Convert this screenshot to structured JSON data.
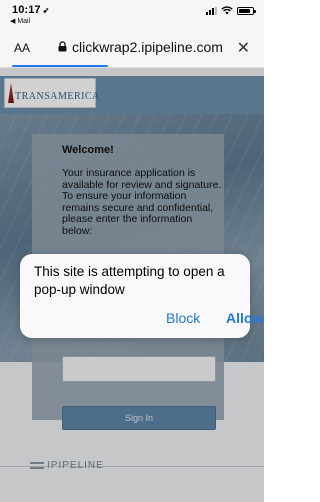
{
  "status_bar": {
    "time": "10:17",
    "location_glyph": "➶",
    "back_app": "◀ Mail"
  },
  "address_bar": {
    "text_size_label": "AA",
    "url": "clickwrap2.ipipeline.com",
    "close": "✕"
  },
  "page": {
    "logo": "TRANSAMERICA",
    "welcome": "Welcome!",
    "intro": "Your insurance application is available for review and signature. To ensure your information remains secure and confidential, please enter the information below:",
    "sign_in": "Sign In",
    "footer_logo": "IPIPELINE"
  },
  "dialog": {
    "message": "This site is attempting to open a pop-up window",
    "block": "Block",
    "allow": "Allow"
  },
  "colors": {
    "accent": "#1f7ae0",
    "header_band": "#6d90ad",
    "signin": "#5f87aa"
  }
}
